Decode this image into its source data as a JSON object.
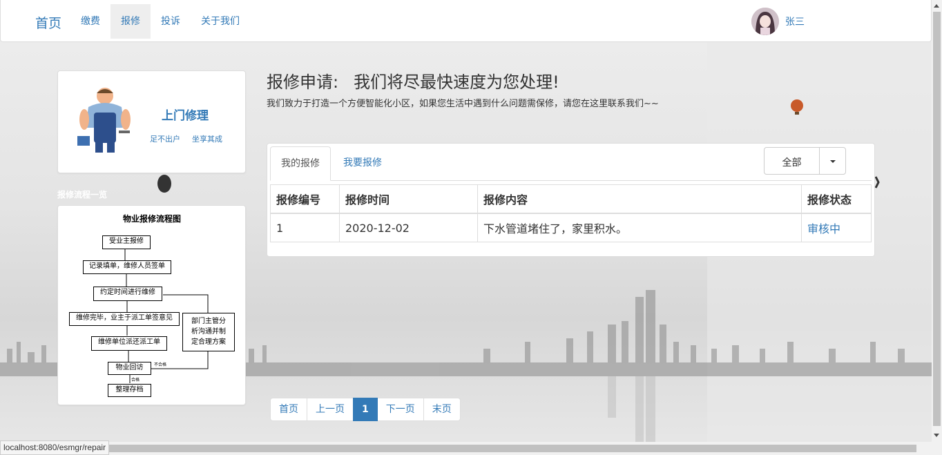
{
  "navbar": {
    "brand": "首页",
    "items": [
      {
        "label": "缴费"
      },
      {
        "label": "报修"
      },
      {
        "label": "投诉"
      },
      {
        "label": "关于我们"
      }
    ],
    "user_name": "张三"
  },
  "service_card": {
    "title": "上门修理",
    "tags": [
      "足不出户",
      "坐享其成"
    ]
  },
  "flow_section": {
    "label": "报修流程一览",
    "chart_title": "物业报修流程图",
    "steps": [
      "受业主报修",
      "记录填单，维修人员签单",
      "约定时间进行维修",
      "维修完毕，业主于派工单签意见",
      "维修单位派还派工单",
      "物业回访",
      "整理存档"
    ],
    "side_box_lines": [
      "部门主管分",
      "析沟通并制",
      "定合理方案"
    ],
    "not_ok_label": "不合格",
    "ok_label": "合格"
  },
  "heading": {
    "title": "报修申请:",
    "subtitle": "我们将尽最快速度为您处理!",
    "lead": "我们致力于打造一个方便智能化小区，如果您生活中遇到什么问题需保修，请您在这里联系我们~~"
  },
  "panel": {
    "tabs": [
      {
        "label": "我的报修"
      },
      {
        "label": "我要报修"
      }
    ],
    "filter": {
      "selected": "全部"
    },
    "table": {
      "headers": [
        "报修编号",
        "报修时间",
        "报修内容",
        "报修状态"
      ],
      "rows": [
        {
          "id": "1",
          "date": "2020-12-02",
          "content": "下水管道堵住了，家里积水。",
          "status": "审核中"
        }
      ]
    }
  },
  "pagination": {
    "first": "首页",
    "prev": "上一页",
    "current": "1",
    "next": "下一页",
    "last": "末页"
  },
  "status_bar": {
    "url": "localhost:8080/esmgr/repair"
  },
  "colors": {
    "link": "#337ab7",
    "border": "#ddd",
    "active_tab_bg": "#eeeeee"
  }
}
